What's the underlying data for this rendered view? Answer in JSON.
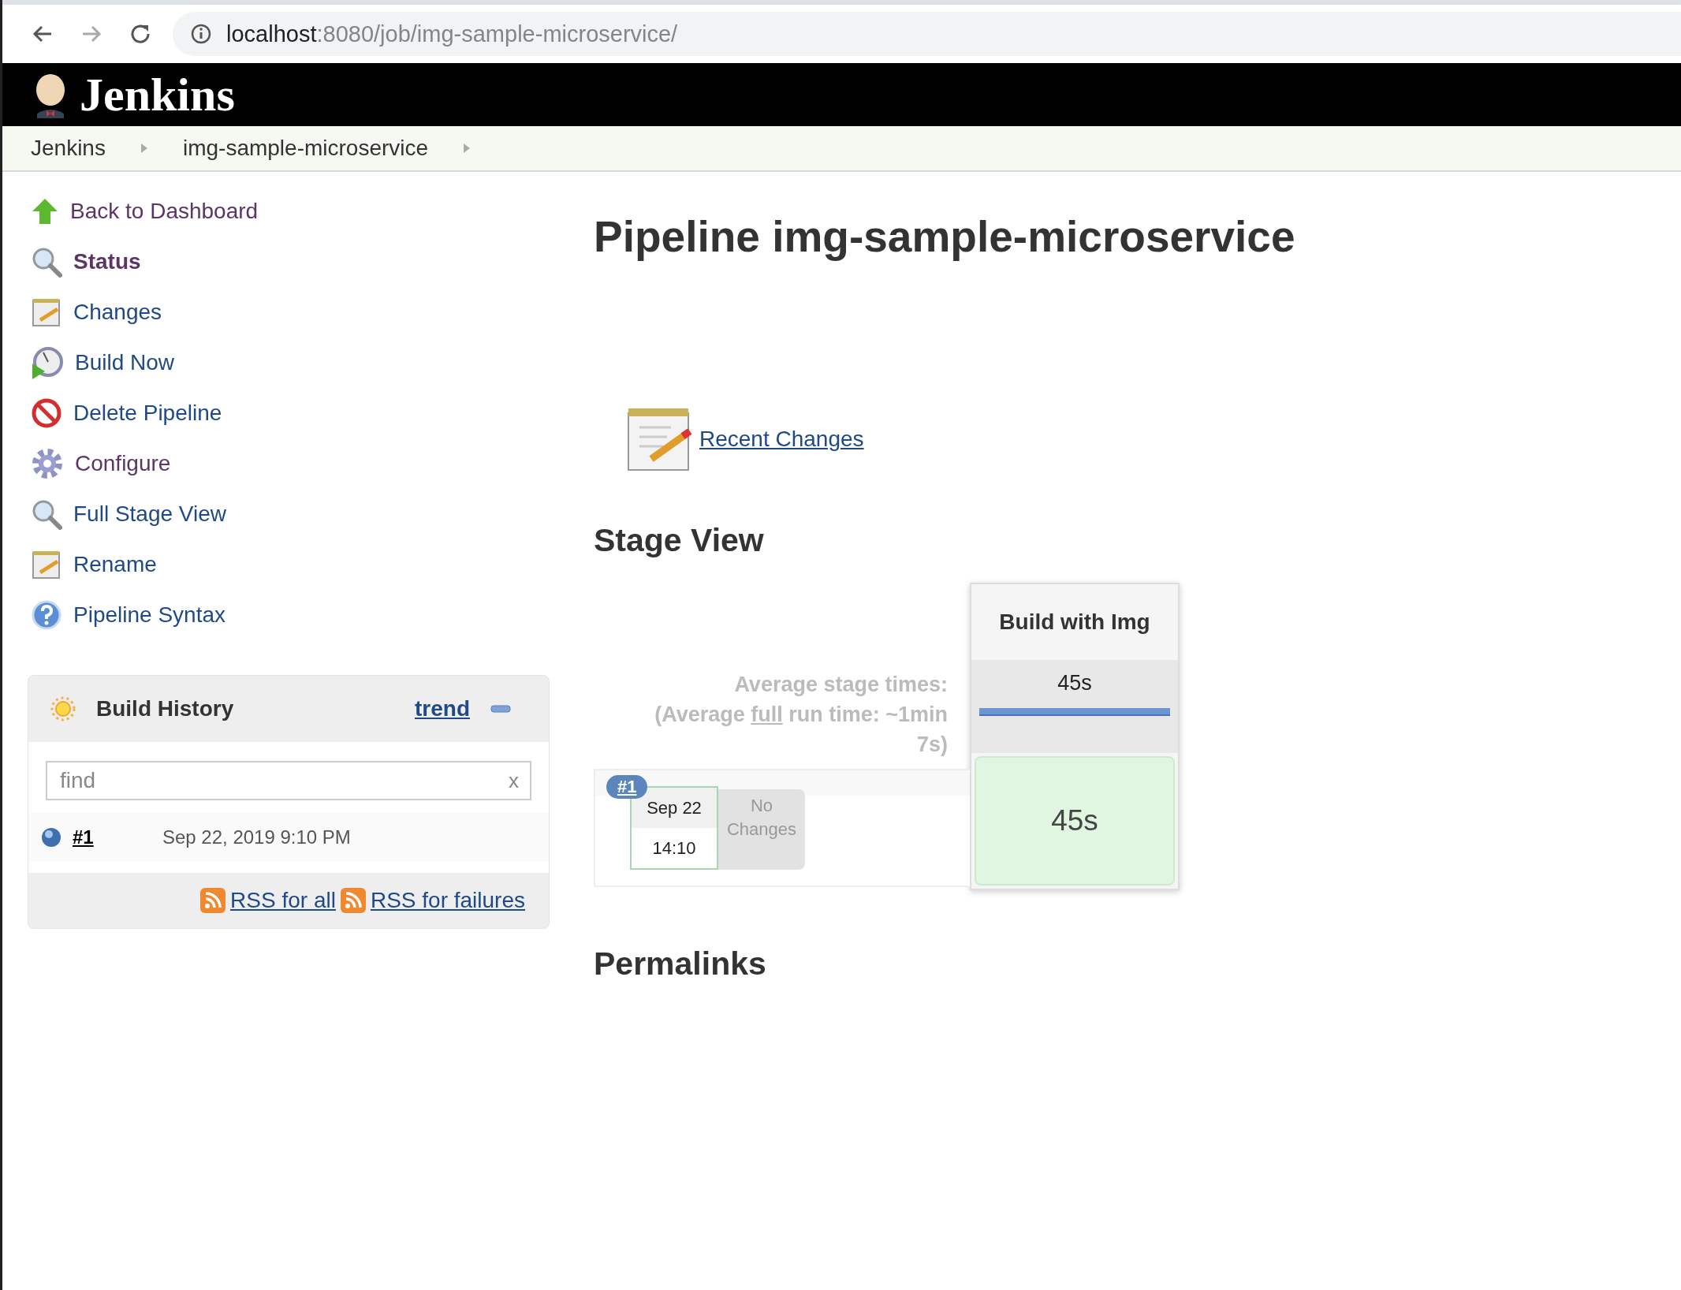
{
  "browser": {
    "url_host": "localhost",
    "url_path": ":8080/job/img-sample-microservice/"
  },
  "header": {
    "logo_text": "Jenkins"
  },
  "breadcrumbs": [
    {
      "label": "Jenkins"
    },
    {
      "label": "img-sample-microservice"
    }
  ],
  "sidebar": {
    "items": [
      {
        "label": "Back to Dashboard",
        "visited": true,
        "current": false
      },
      {
        "label": "Status",
        "visited": true,
        "current": true
      },
      {
        "label": "Changes",
        "visited": false,
        "current": false
      },
      {
        "label": "Build Now",
        "visited": false,
        "current": false
      },
      {
        "label": "Delete Pipeline",
        "visited": false,
        "current": false
      },
      {
        "label": "Configure",
        "visited": true,
        "current": false
      },
      {
        "label": "Full Stage View",
        "visited": false,
        "current": false
      },
      {
        "label": "Rename",
        "visited": false,
        "current": false
      },
      {
        "label": "Pipeline Syntax",
        "visited": false,
        "current": false
      }
    ]
  },
  "build_history": {
    "title": "Build History",
    "trend": "trend",
    "search": {
      "placeholder": "find",
      "clear": "x"
    },
    "builds": [
      {
        "number": "#1",
        "date": "Sep 22, 2019 9:10 PM"
      }
    ],
    "rss": [
      {
        "label": "RSS for all"
      },
      {
        "label": "RSS for failures"
      }
    ]
  },
  "main": {
    "title": "Pipeline img-sample-microservice",
    "recent_changes": "Recent Changes",
    "stage_view": {
      "heading": "Stage View",
      "avg_label": "Average stage times:",
      "avg_full_prefix": "(Average ",
      "avg_full_link": "full",
      "avg_full_suffix": " run time: ~1min 7s)",
      "stages": [
        {
          "name": "Build with Img",
          "avg": "45s",
          "level": 1
        }
      ],
      "runs": [
        {
          "badge": "#1",
          "date": "Sep 22",
          "time": "14:10",
          "changes": "No Changes",
          "cells": [
            "45s"
          ]
        }
      ]
    },
    "permalinks": "Permalinks"
  }
}
